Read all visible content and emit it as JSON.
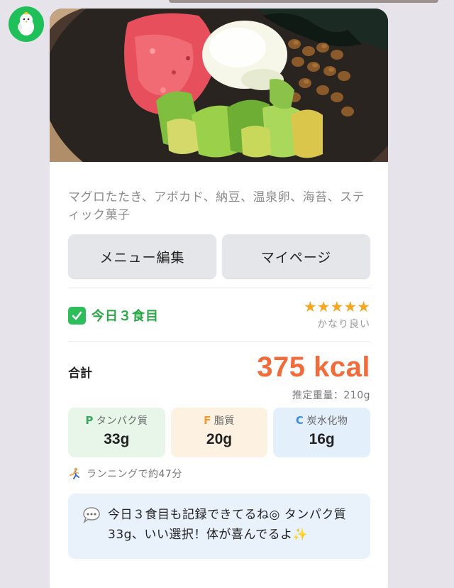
{
  "meal": {
    "description": "マグロたたき、アボカド、納豆、温泉卵、海苔、スティック菓子",
    "meal_label": "今日３食目",
    "rating_label": "かなり良い",
    "rating_stars": 5
  },
  "buttons": {
    "edit_menu": "メニュー編集",
    "my_page": "マイページ"
  },
  "totals": {
    "label": "合計",
    "kcal": "375 kcal",
    "weight": "推定重量：210g"
  },
  "macros": {
    "protein": {
      "letter": "P",
      "name": "タンパク質",
      "value": "33g"
    },
    "fat": {
      "letter": "F",
      "name": "脂質",
      "value": "20g"
    },
    "carbs": {
      "letter": "C",
      "name": "炭水化物",
      "value": "16g"
    }
  },
  "exercise": {
    "text": "ランニングで約47分"
  },
  "message": {
    "text": "今日３食目も記録できてるね◎ タンパク質 33g、いい選択！体が喜んでるよ✨"
  },
  "colors": {
    "kcal": "#f26b3a",
    "meal_label": "#28a745",
    "stars": "#f5a623",
    "avatar_bg": "#1fbf5a"
  }
}
